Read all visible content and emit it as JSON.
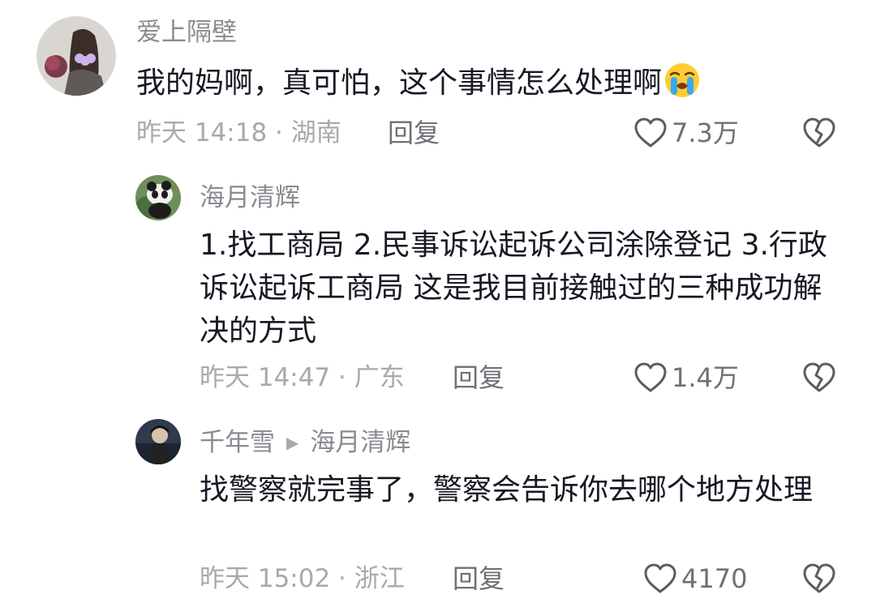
{
  "comments": [
    {
      "username": "爱上隔壁",
      "text": "我的妈啊，真可怕，这个事情怎么处理啊",
      "emoji_icon": "loudly-crying-face-icon",
      "time_location": "昨天 14:18 · 湖南",
      "reply_label": "回复",
      "likes": "7.3万"
    },
    {
      "username": "海月清辉",
      "text": "1.找工商局 2.民事诉讼起诉公司涂除登记 3.行政诉讼起诉工商局 这是我目前接触过的三种成功解决的方式",
      "time_location": "昨天 14:47 · 广东",
      "reply_label": "回复",
      "likes": "1.4万"
    },
    {
      "username": "千年雪",
      "reply_to": "海月清辉",
      "text": "找警察就完事了，警察会告诉你去哪个地方处理",
      "time_location": "昨天 15:02 · 浙江",
      "reply_label": "回复",
      "likes": "4170"
    }
  ],
  "colors": {
    "text": "#161823",
    "username": "#8a8b91",
    "meta": "#a8a9ae",
    "action": "#6f7076"
  }
}
